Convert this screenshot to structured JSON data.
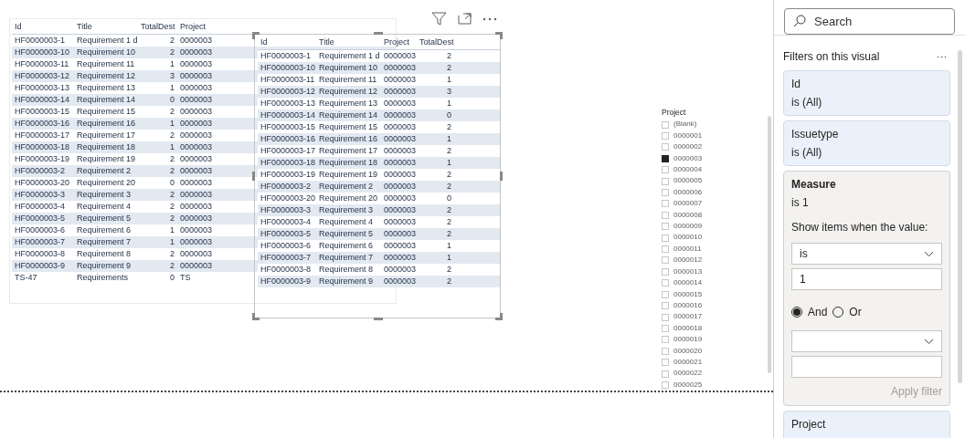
{
  "table_1": {
    "columns": [
      "Id",
      "Title",
      "TotalDest",
      "Project"
    ],
    "rows": [
      [
        "HF0000003-1",
        "Requirement 1 d",
        "2",
        "0000003"
      ],
      [
        "HF0000003-10",
        "Requirement 10",
        "2",
        "0000003"
      ],
      [
        "HF0000003-11",
        "Requirement 11",
        "1",
        "0000003"
      ],
      [
        "HF0000003-12",
        "Requirement 12",
        "3",
        "0000003"
      ],
      [
        "HF0000003-13",
        "Requirement 13",
        "1",
        "0000003"
      ],
      [
        "HF0000003-14",
        "Requirement 14",
        "0",
        "0000003"
      ],
      [
        "HF0000003-15",
        "Requirement 15",
        "2",
        "0000003"
      ],
      [
        "HF0000003-16",
        "Requirement 16",
        "1",
        "0000003"
      ],
      [
        "HF0000003-17",
        "Requirement 17",
        "2",
        "0000003"
      ],
      [
        "HF0000003-18",
        "Requirement 18",
        "1",
        "0000003"
      ],
      [
        "HF0000003-19",
        "Requirement 19",
        "2",
        "0000003"
      ],
      [
        "HF0000003-2",
        "Requirement 2",
        "2",
        "0000003"
      ],
      [
        "HF0000003-20",
        "Requirement 20",
        "0",
        "0000003"
      ],
      [
        "HF0000003-3",
        "Requirement 3",
        "2",
        "0000003"
      ],
      [
        "HF0000003-4",
        "Requirement 4",
        "2",
        "0000003"
      ],
      [
        "HF0000003-5",
        "Requirement 5",
        "2",
        "0000003"
      ],
      [
        "HF0000003-6",
        "Requirement 6",
        "1",
        "0000003"
      ],
      [
        "HF0000003-7",
        "Requirement 7",
        "1",
        "0000003"
      ],
      [
        "HF0000003-8",
        "Requirement 8",
        "2",
        "0000003"
      ],
      [
        "HF0000003-9",
        "Requirement 9",
        "2",
        "0000003"
      ],
      [
        "TS-47",
        "Requirements",
        "0",
        "TS"
      ]
    ]
  },
  "table_2": {
    "columns": [
      "Id",
      "Title",
      "Project",
      "TotalDest"
    ],
    "rows": [
      [
        "HF0000003-1",
        "Requirement 1 d",
        "0000003",
        "2"
      ],
      [
        "HF0000003-10",
        "Requirement 10",
        "0000003",
        "2"
      ],
      [
        "HF0000003-11",
        "Requirement 11",
        "0000003",
        "1"
      ],
      [
        "HF0000003-12",
        "Requirement 12",
        "0000003",
        "3"
      ],
      [
        "HF0000003-13",
        "Requirement 13",
        "0000003",
        "1"
      ],
      [
        "HF0000003-14",
        "Requirement 14",
        "0000003",
        "0"
      ],
      [
        "HF0000003-15",
        "Requirement 15",
        "0000003",
        "2"
      ],
      [
        "HF0000003-16",
        "Requirement 16",
        "0000003",
        "1"
      ],
      [
        "HF0000003-17",
        "Requirement 17",
        "0000003",
        "2"
      ],
      [
        "HF0000003-18",
        "Requirement 18",
        "0000003",
        "1"
      ],
      [
        "HF0000003-19",
        "Requirement 19",
        "0000003",
        "2"
      ],
      [
        "HF0000003-2",
        "Requirement 2",
        "0000003",
        "2"
      ],
      [
        "HF0000003-20",
        "Requirement 20",
        "0000003",
        "0"
      ],
      [
        "HF0000003-3",
        "Requirement 3",
        "0000003",
        "2"
      ],
      [
        "HF0000003-4",
        "Requirement 4",
        "0000003",
        "2"
      ],
      [
        "HF0000003-5",
        "Requirement 5",
        "0000003",
        "2"
      ],
      [
        "HF0000003-6",
        "Requirement 6",
        "0000003",
        "1"
      ],
      [
        "HF0000003-7",
        "Requirement 7",
        "0000003",
        "1"
      ],
      [
        "HF0000003-8",
        "Requirement 8",
        "0000003",
        "2"
      ],
      [
        "HF0000003-9",
        "Requirement 9",
        "0000003",
        "2"
      ]
    ]
  },
  "slicer": {
    "title": "Project",
    "items": [
      {
        "label": "(Blank)",
        "checked": false
      },
      {
        "label": "0000001",
        "checked": false
      },
      {
        "label": "0000002",
        "checked": false
      },
      {
        "label": "0000003",
        "checked": true
      },
      {
        "label": "0000004",
        "checked": false
      },
      {
        "label": "0000005",
        "checked": false
      },
      {
        "label": "0000006",
        "checked": false
      },
      {
        "label": "0000007",
        "checked": false
      },
      {
        "label": "0000008",
        "checked": false
      },
      {
        "label": "0000009",
        "checked": false
      },
      {
        "label": "0000010",
        "checked": false
      },
      {
        "label": "0000011",
        "checked": false
      },
      {
        "label": "0000012",
        "checked": false
      },
      {
        "label": "0000013",
        "checked": false
      },
      {
        "label": "0000014",
        "checked": false
      },
      {
        "label": "0000015",
        "checked": false
      },
      {
        "label": "0000016",
        "checked": false
      },
      {
        "label": "0000017",
        "checked": false
      },
      {
        "label": "0000018",
        "checked": false
      },
      {
        "label": "0000019",
        "checked": false
      },
      {
        "label": "0000020",
        "checked": false
      },
      {
        "label": "0000021",
        "checked": false
      },
      {
        "label": "0000022",
        "checked": false
      },
      {
        "label": "0000025",
        "checked": false
      }
    ]
  },
  "filter_pane": {
    "search": {
      "placeholder": "Search"
    },
    "section_title": "Filters on this visual",
    "filters": [
      {
        "kind": "collapsed",
        "name": "Id",
        "summary": "is (All)"
      },
      {
        "kind": "collapsed",
        "name": "Issuetype",
        "summary": "is (All)"
      },
      {
        "kind": "expanded",
        "name": "Measure",
        "summary": "is 1",
        "prompt": "Show items when the value:",
        "condition_1": "is",
        "value_1": "1",
        "logic": [
          {
            "label": "And",
            "selected": true
          },
          {
            "label": "Or",
            "selected": false
          }
        ],
        "apply": {
          "label": "Apply filter",
          "disabled": true
        }
      },
      {
        "kind": "cut",
        "name": "Project"
      }
    ]
  }
}
